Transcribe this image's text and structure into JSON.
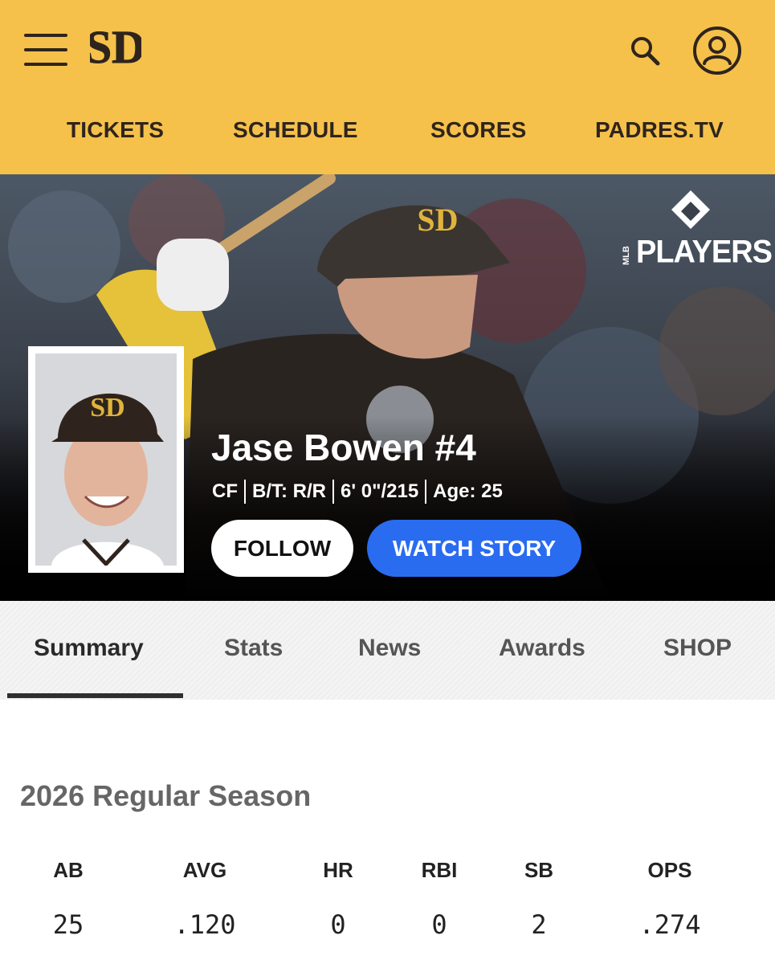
{
  "header": {
    "logo_text": "SD",
    "colors": {
      "brand_gold": "#f5c14a",
      "brand_brown": "#2f241d",
      "accent_blue": "#2a6cf0"
    },
    "icons": [
      "hamburger-menu-icon",
      "padres-logo",
      "search-icon",
      "account-icon"
    ],
    "nav": [
      {
        "label": "TICKETS"
      },
      {
        "label": "SCHEDULE"
      },
      {
        "label": "SCORES"
      },
      {
        "label": "PADRES.TV"
      }
    ]
  },
  "hero": {
    "partner_logo": {
      "small": "MLB",
      "big": "PLAYERS"
    },
    "player_name": "Jase Bowen #4",
    "position": "CF",
    "bats_throws": "B/T: R/R",
    "height_weight": "6' 0\"/215",
    "age": "Age: 25",
    "follow_label": "FOLLOW",
    "watch_label": "WATCH STORY"
  },
  "tabs": [
    {
      "label": "Summary",
      "active": true
    },
    {
      "label": "Stats",
      "active": false
    },
    {
      "label": "News",
      "active": false
    },
    {
      "label": "Awards",
      "active": false
    },
    {
      "label": "SHOP",
      "active": false
    }
  ],
  "season": {
    "title": "2026 Regular Season",
    "stats": [
      {
        "label": "AB",
        "value": "25"
      },
      {
        "label": "AVG",
        "value": ".120"
      },
      {
        "label": "HR",
        "value": "0"
      },
      {
        "label": "RBI",
        "value": "0"
      },
      {
        "label": "SB",
        "value": "2"
      },
      {
        "label": "OPS",
        "value": ".274"
      }
    ]
  }
}
